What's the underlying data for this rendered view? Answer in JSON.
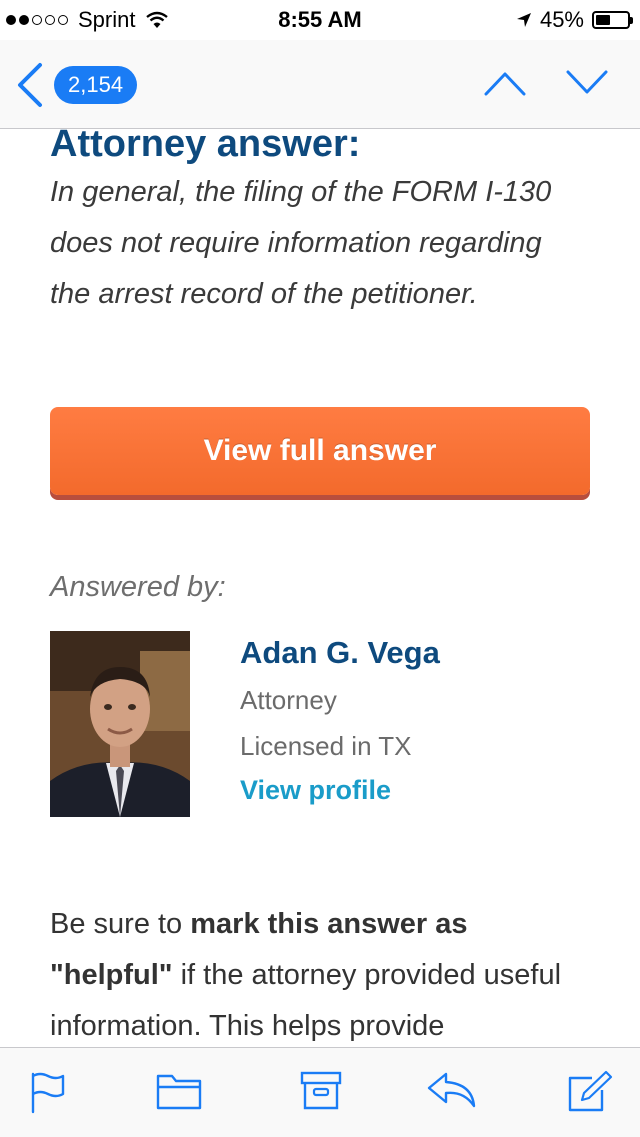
{
  "status_bar": {
    "carrier": "Sprint",
    "time": "8:55 AM",
    "battery": "45%",
    "signal_bars_filled": 2,
    "signal_bars_total": 5,
    "battery_level": 0.45
  },
  "nav": {
    "message_count": "2,154"
  },
  "content": {
    "heading": "Attorney answer:",
    "answer_text": "In general, the filing of the FORM I-130 does not require information regarding the arrest record of the petitioner.",
    "view_full_answer_label": "View full answer",
    "answered_by_label": "Answered by:",
    "attorney": {
      "name": "Adan G. Vega",
      "title": "Attorney",
      "license": "Licensed in TX",
      "view_profile_label": "View profile"
    },
    "helpful_note": {
      "part1": "Be sure to ",
      "bold1": "mark this answer as",
      "bold2": "\"helpful\"",
      "part2": " if the attorney provided useful information. This helps provide"
    }
  },
  "colors": {
    "accent": "#1a7cf5",
    "heading": "#0e4a7e",
    "button": "#f36a2c",
    "link": "#1a9cc9"
  },
  "toolbar": {
    "icons": [
      "flag-icon",
      "folder-icon",
      "archive-icon",
      "reply-icon",
      "compose-icon"
    ]
  }
}
